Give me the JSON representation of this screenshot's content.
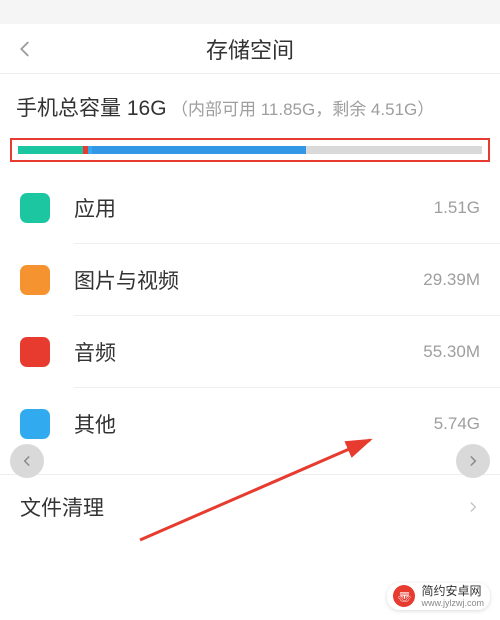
{
  "header": {
    "title": "存储空间"
  },
  "summary": {
    "main": "手机总容量 16G",
    "sub": "（内部可用 11.85G，剩余 4.51G）"
  },
  "bar": {
    "segments": [
      {
        "name": "apps",
        "color": "#1bc6a0",
        "width_pct": 14
      },
      {
        "name": "pics",
        "color": "#e63b2e",
        "width_pct": 1
      },
      {
        "name": "audio",
        "color": "#32aaf0",
        "width_pct": 1
      },
      {
        "name": "other",
        "color": "#3298e6",
        "width_pct": 46
      }
    ]
  },
  "items": [
    {
      "icon_color": "#1bc6a0",
      "label": "应用",
      "value": "1.51G"
    },
    {
      "icon_color": "#f59331",
      "label": "图片与视频",
      "value": "29.39M"
    },
    {
      "icon_color": "#e63b2e",
      "label": "音频",
      "value": "55.30M"
    },
    {
      "icon_color": "#32aaf0",
      "label": "其他",
      "value": "5.74G"
    }
  ],
  "cleanup": {
    "label": "文件清理"
  },
  "watermark": {
    "name": "简约安卓网",
    "url": "www.jylzwj.com"
  }
}
